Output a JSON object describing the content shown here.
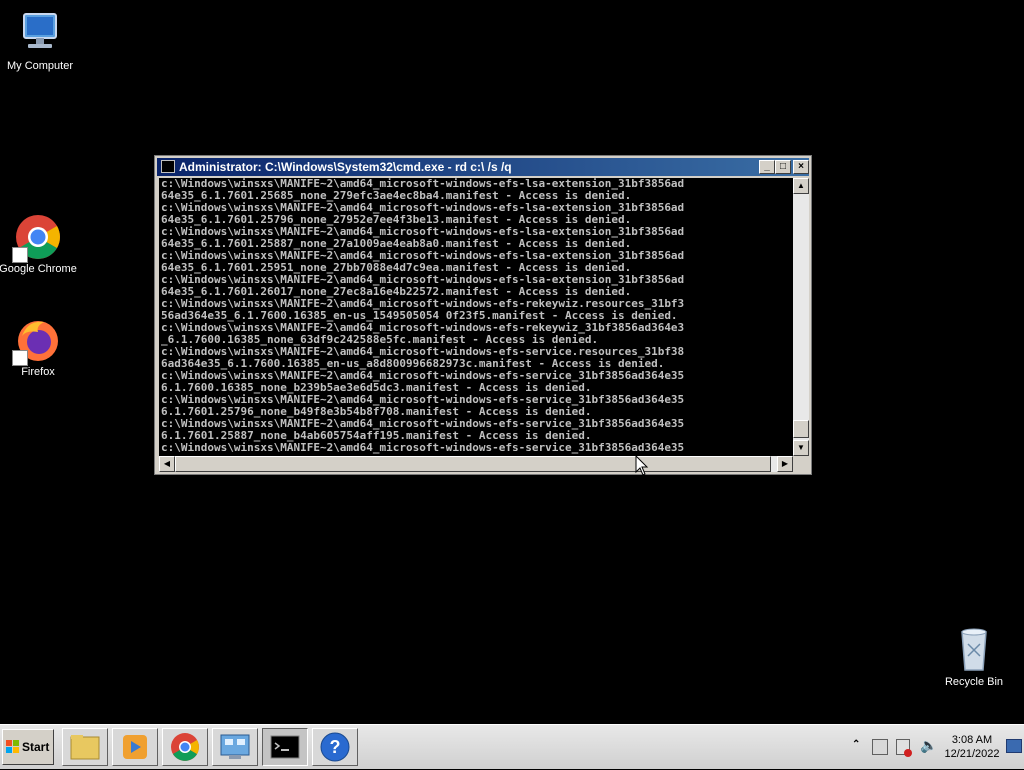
{
  "desktop": {
    "icons": [
      {
        "label": "My Computer",
        "icon": "computer-icon"
      },
      {
        "label": "Google Chrome",
        "icon": "chrome-icon"
      },
      {
        "label": "Firefox",
        "icon": "firefox-icon"
      },
      {
        "label": "Recycle Bin",
        "icon": "recycle-bin-icon"
      }
    ]
  },
  "cmd_window": {
    "title": "Administrator: C:\\Windows\\System32\\cmd.exe - rd  c:\\ /s /q",
    "controls": {
      "minimize": "_",
      "maximize": "□",
      "close": "×"
    },
    "lines": [
      "c:\\Windows\\winsxs\\MANIFE~2\\amd64_microsoft-windows-efs-lsa-extension_31bf3856ad",
      "64e35_6.1.7601.25685_none_279efc3ae4ec8ba4.manifest - Access is denied.",
      "c:\\Windows\\winsxs\\MANIFE~2\\amd64_microsoft-windows-efs-lsa-extension_31bf3856ad",
      "64e35_6.1.7601.25796_none_27952e7ee4f3be13.manifest - Access is denied.",
      "c:\\Windows\\winsxs\\MANIFE~2\\amd64_microsoft-windows-efs-lsa-extension_31bf3856ad",
      "64e35_6.1.7601.25887_none_27a1009ae4eab8a0.manifest - Access is denied.",
      "c:\\Windows\\winsxs\\MANIFE~2\\amd64_microsoft-windows-efs-lsa-extension_31bf3856ad",
      "64e35_6.1.7601.25951_none_27bb7088e4d7c9ea.manifest - Access is denied.",
      "c:\\Windows\\winsxs\\MANIFE~2\\amd64_microsoft-windows-efs-lsa-extension_31bf3856ad",
      "64e35_6.1.7601.26017_none_27ec8a16e4b22572.manifest - Access is denied.",
      "c:\\Windows\\winsxs\\MANIFE~2\\amd64_microsoft-windows-efs-rekeywiz.resources_31bf3",
      "56ad364e35_6.1.7600.16385_en-us_1549505054 0f23f5.manifest - Access is denied.",
      "c:\\Windows\\winsxs\\MANIFE~2\\amd64_microsoft-windows-efs-rekeywiz_31bf3856ad364e3",
      "_6.1.7600.16385_none_63df9c242588e5fc.manifest - Access is denied.",
      "c:\\Windows\\winsxs\\MANIFE~2\\amd64_microsoft-windows-efs-service.resources_31bf38",
      "6ad364e35_6.1.7600.16385_en-us_a8d800996682973c.manifest - Access is denied.",
      "c:\\Windows\\winsxs\\MANIFE~2\\amd64_microsoft-windows-efs-service_31bf3856ad364e35",
      "6.1.7600.16385_none_b239b5ae3e6d5dc3.manifest - Access is denied.",
      "c:\\Windows\\winsxs\\MANIFE~2\\amd64_microsoft-windows-efs-service_31bf3856ad364e35",
      "6.1.7601.25796_none_b49f8e3b54b8f708.manifest - Access is denied.",
      "c:\\Windows\\winsxs\\MANIFE~2\\amd64_microsoft-windows-efs-service_31bf3856ad364e35",
      "6.1.7601.25887_none_b4ab605754aff195.manifest - Access is denied.",
      "c:\\Windows\\winsxs\\MANIFE~2\\amd64_microsoft-windows-efs-service_31bf3856ad364e35"
    ],
    "colors": {
      "background": "#000000",
      "text": "#c0c0c0"
    }
  },
  "taskbar": {
    "start_label": "Start",
    "buttons": [
      {
        "name": "explorer",
        "icon": "folder-icon"
      },
      {
        "name": "media-player",
        "icon": "media-player-icon"
      },
      {
        "name": "chrome",
        "icon": "chrome-icon"
      },
      {
        "name": "control-panel",
        "icon": "control-panel-icon"
      },
      {
        "name": "cmd",
        "icon": "cmd-icon",
        "active": true
      },
      {
        "name": "help",
        "icon": "help-icon"
      }
    ],
    "tray": {
      "time": "3:08 AM",
      "date": "12/21/2022",
      "icons": [
        "show-hidden-icon",
        "network-icon",
        "action-center-icon",
        "volume-icon",
        "show-desktop-icon"
      ]
    }
  }
}
